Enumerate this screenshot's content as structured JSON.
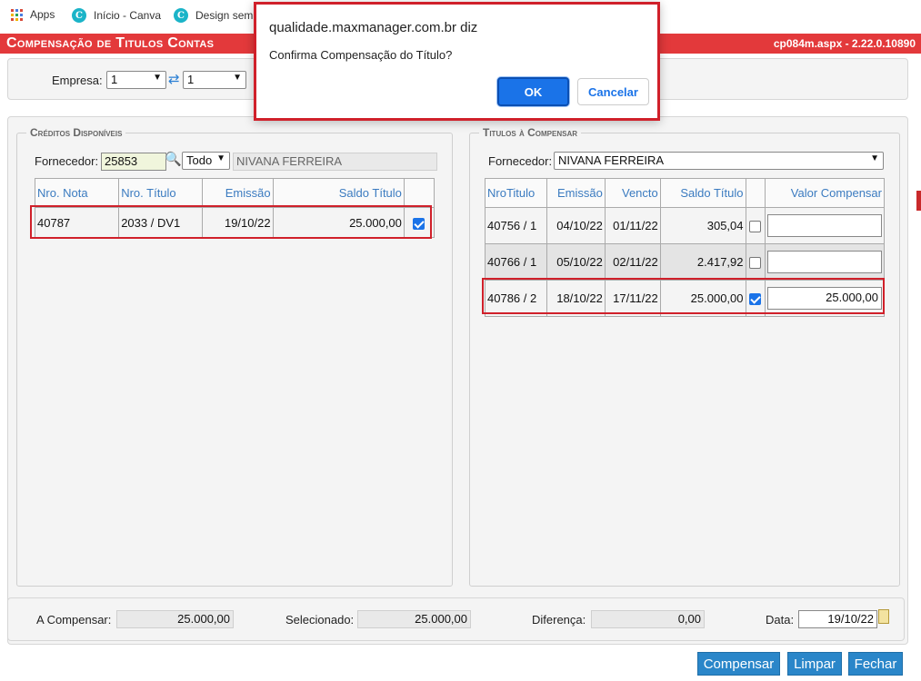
{
  "bookmarks": [
    {
      "label": "Apps",
      "icon": "apps-grid-icon"
    },
    {
      "label": "Início - Canva",
      "icon": "canva-icon"
    },
    {
      "label": "Design sem",
      "icon": "canva-icon"
    }
  ],
  "header": {
    "title": "Compensação de Titulos Contas",
    "version": "cp084m.aspx - 2.22.0.10890"
  },
  "filter": {
    "empresa_label": "Empresa:",
    "empresa_value": "1",
    "empresa2_value": "1"
  },
  "creditos": {
    "legend": "Créditos Disponíveis",
    "fornecedor_label": "Fornecedor:",
    "fornecedor_code": "25853",
    "filter_value": "Todo",
    "fornecedor_name": "NIVANA FERREIRA",
    "columns": [
      "Nro. Nota",
      "Nro. Título",
      "Emissão",
      "Saldo Título"
    ],
    "rows": [
      {
        "nota": "40787",
        "titulo": "2033 / DV1",
        "emissao": "19/10/22",
        "saldo": "25.000,00",
        "checked": true
      }
    ]
  },
  "titulos": {
    "legend": "Titulos à Compensar",
    "fornecedor_label": "Fornecedor:",
    "fornecedor_value": "NIVANA FERREIRA",
    "columns": [
      "NroTitulo",
      "Emissão",
      "Vencto",
      "Saldo Título",
      "Valor Compensar"
    ],
    "rows": [
      {
        "titulo": "40756 / 1",
        "emissao": "04/10/22",
        "vencto": "01/11/22",
        "saldo": "305,04",
        "checked": false,
        "valor": ""
      },
      {
        "titulo": "40766 / 1",
        "emissao": "05/10/22",
        "vencto": "02/11/22",
        "saldo": "2.417,92",
        "checked": false,
        "valor": ""
      },
      {
        "titulo": "40786 / 2",
        "emissao": "18/10/22",
        "vencto": "17/11/22",
        "saldo": "25.000,00",
        "checked": true,
        "valor": "25.000,00"
      }
    ]
  },
  "totals": {
    "a_compensar_label": "A Compensar:",
    "a_compensar_value": "25.000,00",
    "selecionado_label": "Selecionado:",
    "selecionado_value": "25.000,00",
    "diferenca_label": "Diferença:",
    "diferenca_value": "0,00",
    "data_label": "Data:",
    "data_value": "19/10/22"
  },
  "actions": {
    "compensar": "Compensar",
    "limpar": "Limpar",
    "fechar": "Fechar"
  },
  "dialog": {
    "host": "qualidade.maxmanager.com.br diz",
    "message": "Confirma Compensação do Título?",
    "ok": "OK",
    "cancel": "Cancelar"
  },
  "colors": {
    "title_bar": "#e3393b",
    "highlight": "#d0202a",
    "button_blue": "#2a86c9",
    "link_blue": "#3b7bc0"
  }
}
